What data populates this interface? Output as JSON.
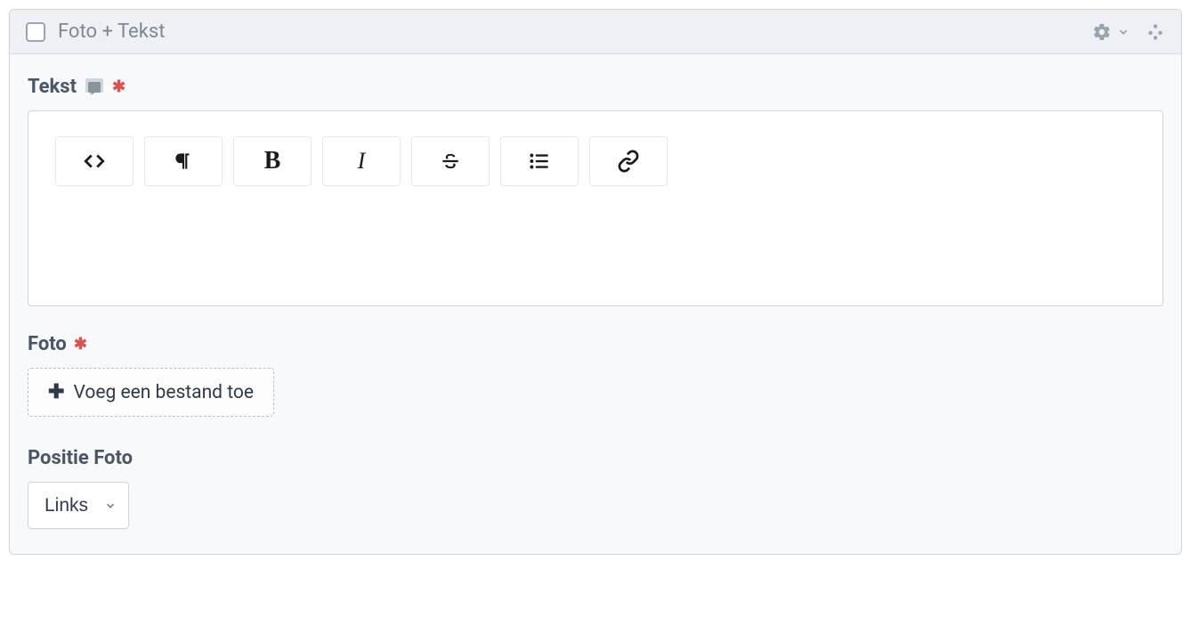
{
  "panel": {
    "title": "Foto + Tekst"
  },
  "fields": {
    "text": {
      "label": "Tekst"
    },
    "photo": {
      "label": "Foto",
      "add_file_label": "Voeg een bestand toe"
    },
    "position": {
      "label": "Positie Foto",
      "selected": "Links"
    }
  }
}
